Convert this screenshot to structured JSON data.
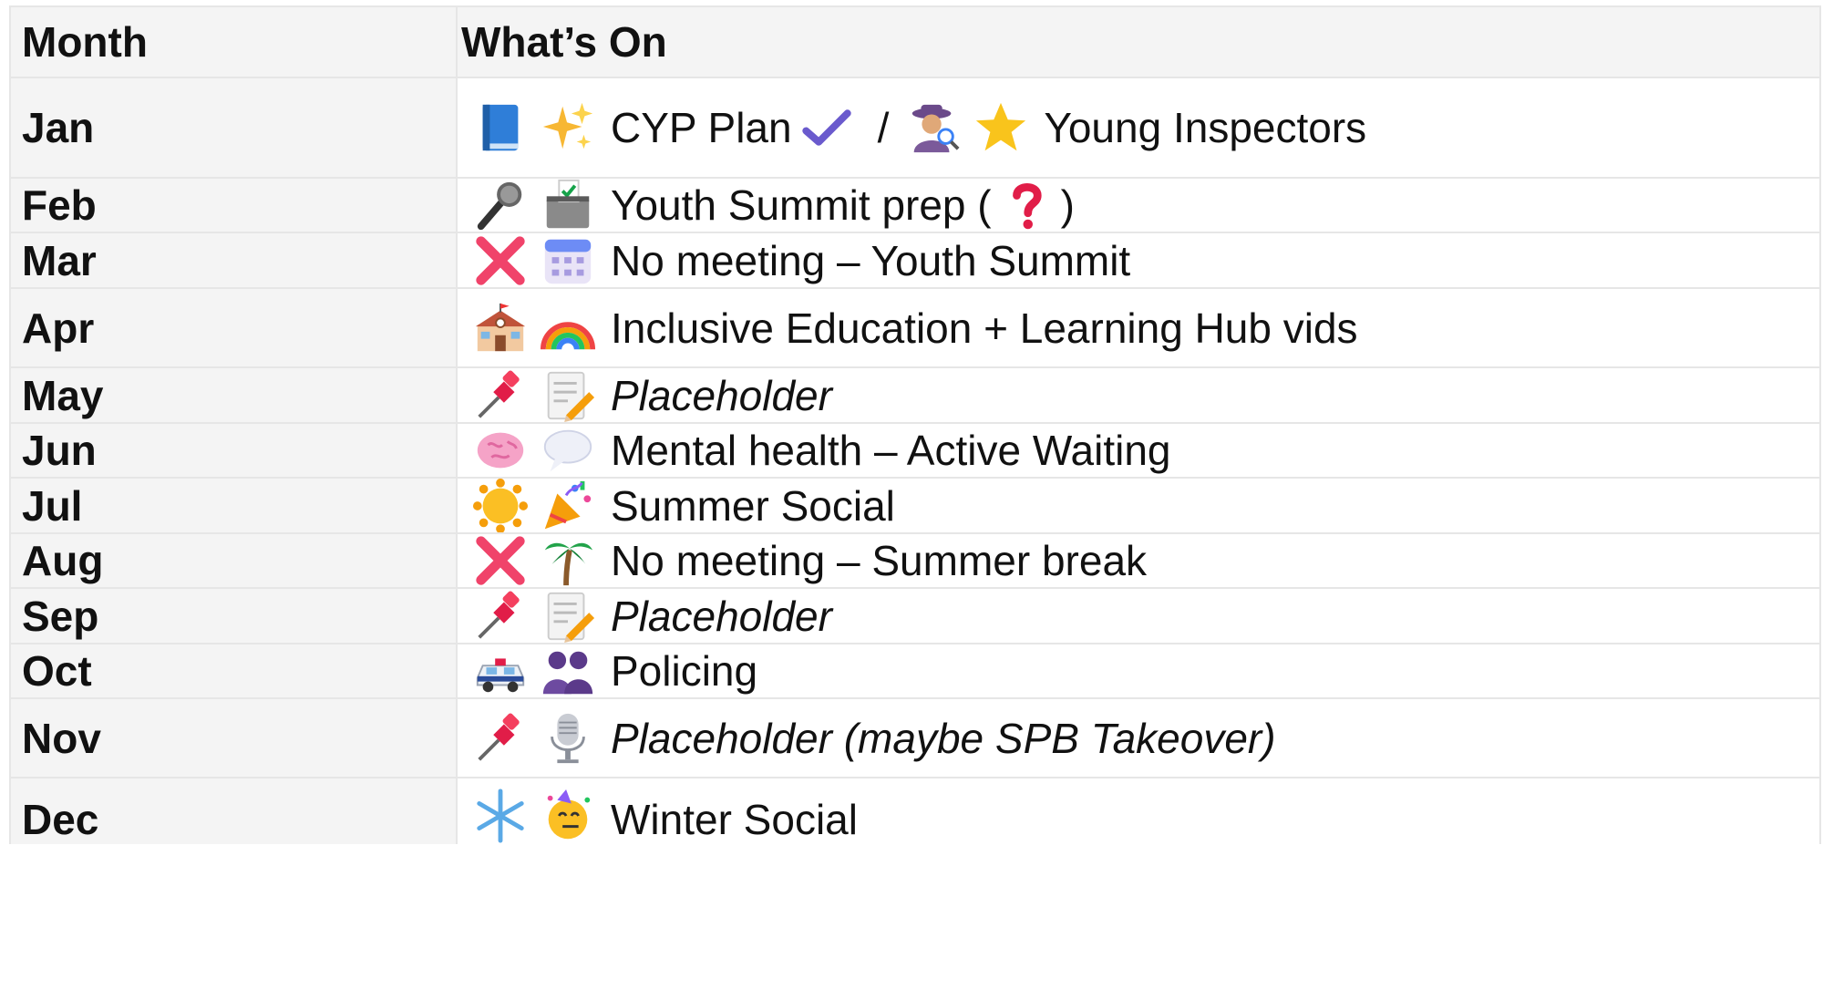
{
  "header": {
    "month": "Month",
    "whats_on": "What’s On"
  },
  "rows": [
    {
      "month": "Jan",
      "icons": [
        "blue-book-icon",
        "sparkles-icon"
      ],
      "text": "CYP Plan",
      "extra": {
        "icon1": "check-mark-icon",
        "sep": "/",
        "icon2": "detective-icon",
        "icon3": "star-icon",
        "text2": "Young Inspectors"
      }
    },
    {
      "month": "Feb",
      "icons": [
        "microphone-icon",
        "ballot-box-icon"
      ],
      "text": "Youth Summit prep (",
      "extra": {
        "icon1": "question-mark-icon",
        "close": ")"
      }
    },
    {
      "month": "Mar",
      "icons": [
        "cross-mark-icon",
        "calendar-icon"
      ],
      "text": "No meeting – Youth Summit"
    },
    {
      "month": "Apr",
      "icons": [
        "school-icon",
        "rainbow-icon"
      ],
      "text": "Inclusive Education + Learning Hub vids"
    },
    {
      "month": "May",
      "icons": [
        "pushpin-icon",
        "memo-icon"
      ],
      "text": "Placeholder",
      "italic": true
    },
    {
      "month": "Jun",
      "icons": [
        "brain-icon",
        "speech-bubble-icon"
      ],
      "text": "Mental health – Active Waiting"
    },
    {
      "month": "Jul",
      "icons": [
        "sun-icon",
        "party-popper-icon"
      ],
      "text": "Summer Social"
    },
    {
      "month": "Aug",
      "icons": [
        "cross-mark-icon",
        "palm-tree-icon"
      ],
      "text": "No meeting – Summer break"
    },
    {
      "month": "Sep",
      "icons": [
        "pushpin-icon",
        "memo-icon"
      ],
      "text": "Placeholder",
      "italic": true
    },
    {
      "month": "Oct",
      "icons": [
        "police-car-icon",
        "two-people-icon"
      ],
      "text": "Policing"
    },
    {
      "month": "Nov",
      "icons": [
        "pushpin-icon",
        "studio-microphone-icon"
      ],
      "text": "Placeholder (maybe SPB Takeover)",
      "italic": true
    },
    {
      "month": "Dec",
      "icons": [
        "snowflake-icon",
        "party-face-icon"
      ],
      "text": "Winter Social"
    }
  ],
  "colors": {
    "border": "#e6e6e6",
    "header_bg": "#f4f4f4",
    "month_bg": "#f4f4f4"
  }
}
